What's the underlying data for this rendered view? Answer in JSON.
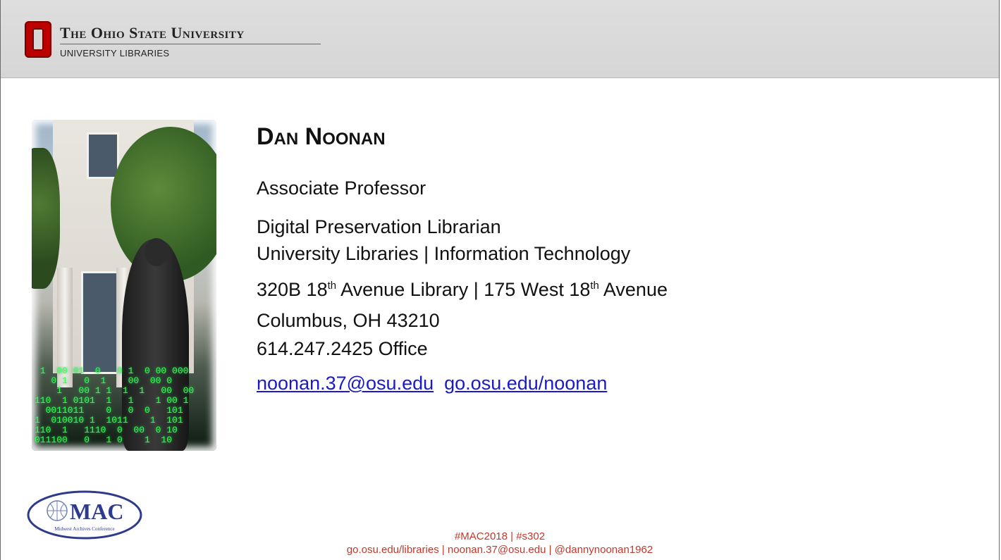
{
  "header": {
    "university": "The Ohio State University",
    "department": "UNIVERSITY LIBRARIES",
    "brand_color": "#bb0000"
  },
  "profile": {
    "name": "Dan Noonan",
    "title": "Associate Professor",
    "role": "Digital Preservation Librarian",
    "unit": "University Libraries | Information Technology",
    "address_part1": "320B 18",
    "address_sup1": "th",
    "address_part2": " Avenue Library | 175 West 18",
    "address_sup2": "th",
    "address_part3": " Avenue",
    "city": "Columbus, OH 43210",
    "phone": "614.247.2425 Office",
    "email": "noonan.37@osu.edu",
    "website": "go.osu.edu/noonan"
  },
  "photo": {
    "binary_text": " 1  00 01  0   0 1  0 00 000\n   0 1   0  1    00  00 0\n    1   00 1 1  1  1   00  00\n110  1 0101  1   1    1 00 1\n  0011011    0   0  0   101\n1  010010 1  1011    1  101\n110  1   1110  0  00  0 10\n011100   0   1 0    1  10"
  },
  "mac_logo": {
    "text": "MAC",
    "subtext": "Midwest Archives Conference"
  },
  "footer": {
    "line1": "#MAC2018 | #s302",
    "line2": "go.osu.edu/libraries | noonan.37@osu.edu | @dannynoonan1962",
    "color": "#c0392b"
  }
}
